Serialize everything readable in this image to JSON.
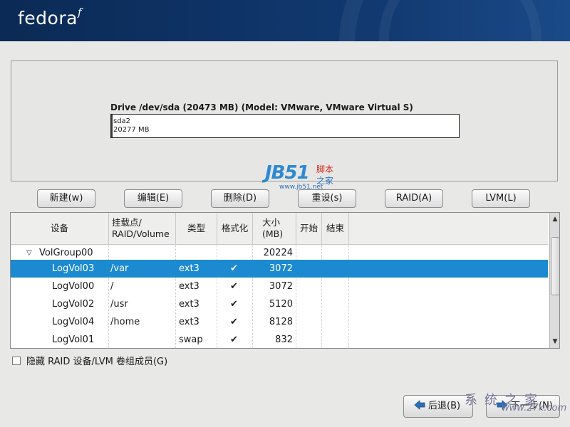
{
  "header": {
    "logo_text": "fedora",
    "logo_mark": "f"
  },
  "drive": {
    "title": "Drive /dev/sda (20473 MB) (Model: VMware, VMware Virtual S)",
    "partition_name": "sda2",
    "partition_size": "20277 MB"
  },
  "watermark": {
    "main": "JB51",
    "cn_top": "脚本",
    "cn_bottom": "之家",
    "url": "www.jb51.net"
  },
  "toolbar": {
    "new_label": "新建(w)",
    "edit_label": "编辑(E)",
    "delete_label": "删除(D)",
    "reset_label": "重设(s)",
    "raid_label": "RAID(A)",
    "lvm_label": "LVM(L)"
  },
  "table": {
    "headers": [
      "设备",
      "挂载点/\nRAID/Volume",
      "类型",
      "格式化",
      "大小\n(MB)",
      "开始",
      "结束"
    ],
    "rows": [
      {
        "device": "VolGroup00",
        "mount": "",
        "type": "",
        "format": "",
        "size": "20224",
        "start": "",
        "end": "",
        "group": true,
        "selected": false
      },
      {
        "device": "LogVol03",
        "mount": "/var",
        "type": "ext3",
        "format": "✔",
        "size": "3072",
        "start": "",
        "end": "",
        "group": false,
        "selected": true
      },
      {
        "device": "LogVol00",
        "mount": "/",
        "type": "ext3",
        "format": "✔",
        "size": "3072",
        "start": "",
        "end": "",
        "group": false,
        "selected": false
      },
      {
        "device": "LogVol02",
        "mount": "/usr",
        "type": "ext3",
        "format": "✔",
        "size": "5120",
        "start": "",
        "end": "",
        "group": false,
        "selected": false
      },
      {
        "device": "LogVol04",
        "mount": "/home",
        "type": "ext3",
        "format": "✔",
        "size": "8128",
        "start": "",
        "end": "",
        "group": false,
        "selected": false
      },
      {
        "device": "LogVol01",
        "mount": "",
        "type": "swap",
        "format": "✔",
        "size": "832",
        "start": "",
        "end": "",
        "group": false,
        "selected": false
      }
    ]
  },
  "hide_raid": {
    "label": "隐藏 RAID 设备/LVM 卷组成员(G)",
    "checked": false
  },
  "nav": {
    "back_label": "后退(B)",
    "next_label": "下一步(N)"
  },
  "watermark2": {
    "text": "系统之家",
    "url": "www.27k.com"
  },
  "colors": {
    "selection": "#1c8ad0",
    "banner": "#0e3366"
  }
}
